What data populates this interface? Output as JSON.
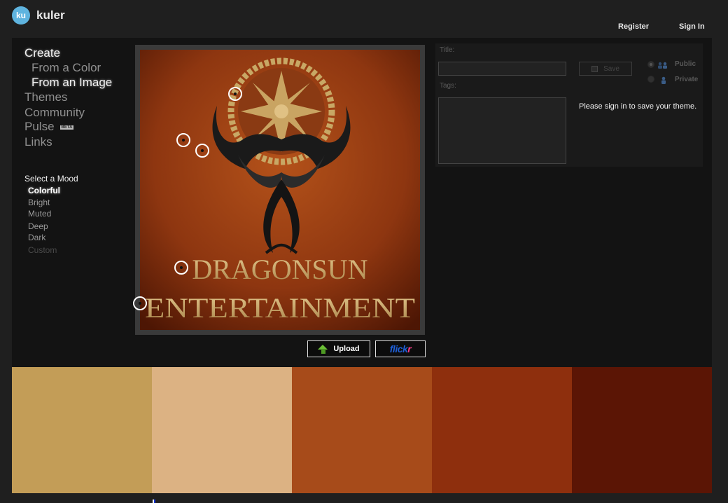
{
  "app": {
    "logo_badge": "ku",
    "logo_text": "kuler"
  },
  "header": {
    "register_label": "Register",
    "signin_label": "Sign In"
  },
  "nav": {
    "create": "Create",
    "from_color": "From a Color",
    "from_image": "From an Image",
    "themes": "Themes",
    "community": "Community",
    "pulse": "Pulse",
    "pulse_badge": "BETA",
    "links": "Links"
  },
  "mood": {
    "heading": "Select a Mood",
    "options": [
      "Colorful",
      "Bright",
      "Muted",
      "Deep",
      "Dark",
      "Custom"
    ],
    "selected": "Colorful"
  },
  "image": {
    "brand_line1": "DRAGONSUN",
    "brand_line2": "ENTERTAINMENT"
  },
  "buttons": {
    "upload_label": "Upload",
    "flickr_label_a": "flick",
    "flickr_label_b": "r"
  },
  "form": {
    "title_label": "Title:",
    "title_value": "",
    "tags_label": "Tags:",
    "tags_value": "",
    "save_label": "Save",
    "public_label": "Public",
    "private_label": "Private",
    "signin_message": "Please sign in to save your theme."
  },
  "theme_colors": [
    "#c39d57",
    "#dcb283",
    "#a74b1a",
    "#8e2f0d",
    "#5b1505"
  ],
  "icons": {
    "upload": "green-up-arrow-icon",
    "public": "people-icon",
    "private": "person-icon",
    "save": "disk-icon"
  }
}
